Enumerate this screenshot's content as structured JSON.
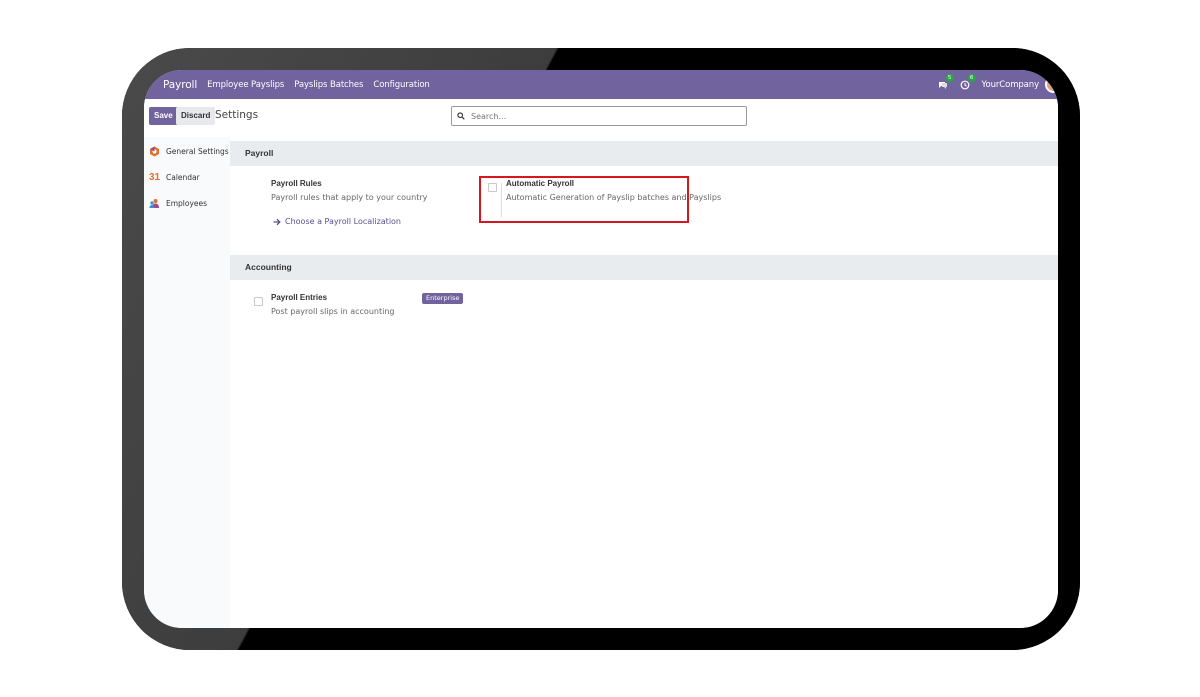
{
  "navbar": {
    "app_title": "Payroll",
    "menu": [
      "Employee Payslips",
      "Payslips Batches",
      "Configuration"
    ],
    "messages_count": "5",
    "activities_count": "6",
    "company": "YourCompany"
  },
  "control_panel": {
    "save_label": "Save",
    "discard_label": "Discard",
    "breadcrumb": "Settings",
    "search_placeholder": "Search..."
  },
  "sidebar": {
    "items": [
      {
        "label": "General Settings",
        "icon": "odoo-logo-icon"
      },
      {
        "label": "Calendar",
        "icon": "calendar-31-icon"
      },
      {
        "label": "Employees",
        "icon": "employees-icon"
      }
    ]
  },
  "sections": {
    "payroll": {
      "title": "Payroll",
      "rules_title": "Payroll Rules",
      "rules_desc": "Payroll rules that apply to your country",
      "rules_link": "Choose a Payroll Localization",
      "auto_title": "Automatic Payroll",
      "auto_desc": "Automatic Generation of Payslip batches and Payslips"
    },
    "accounting": {
      "title": "Accounting",
      "entries_title": "Payroll Entries",
      "entries_desc": "Post payroll slips in accounting",
      "enterprise_badge": "Enterprise"
    }
  },
  "colors": {
    "brand": "#71639e",
    "highlight": "#d7171f"
  }
}
